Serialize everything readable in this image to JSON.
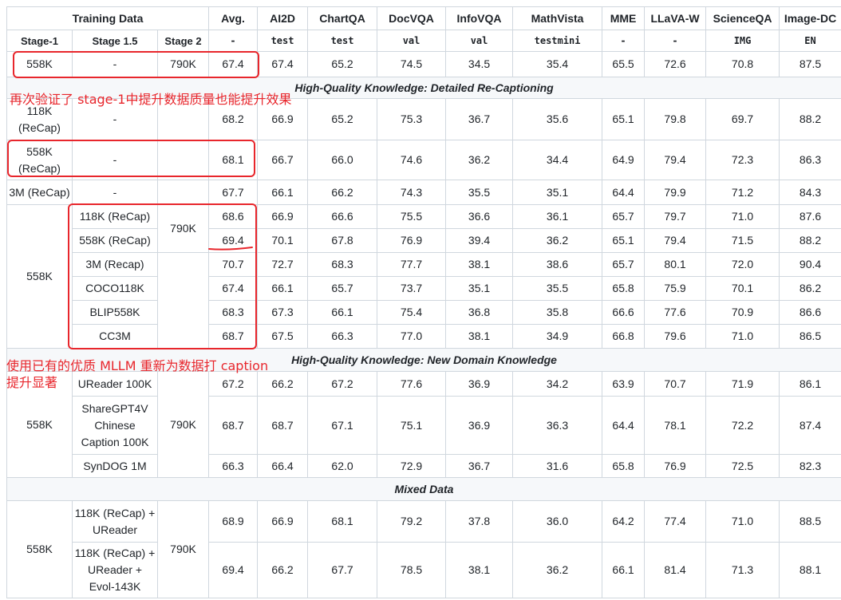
{
  "header": {
    "training_data": "Training Data",
    "metrics": [
      "Avg.",
      "AI2D",
      "ChartQA",
      "DocVQA",
      "InfoVQA",
      "MathVista",
      "MME",
      "LLaVA-W",
      "ScienceQA",
      "Image-DC"
    ],
    "stages": [
      "Stage-1",
      "Stage 1.5",
      "Stage 2"
    ],
    "splits": [
      "-",
      "test",
      "test",
      "val",
      "val",
      "testmini",
      "-",
      "-",
      "IMG",
      "EN"
    ]
  },
  "baseline": {
    "s1": "558K",
    "s15": "-",
    "s2": "790K",
    "values": [
      "67.4",
      "67.4",
      "65.2",
      "74.5",
      "34.5",
      "35.4",
      "65.5",
      "72.6",
      "70.8",
      "87.5"
    ]
  },
  "section1": {
    "title": "High-Quality Knowledge: Detailed Re-Captioning",
    "rows_a": [
      {
        "s1": "118K (ReCap)",
        "s15": "-",
        "values": [
          "68.2",
          "66.9",
          "65.2",
          "75.3",
          "36.7",
          "35.6",
          "65.1",
          "79.8",
          "69.7",
          "88.2"
        ]
      },
      {
        "s1": "558K (ReCap)",
        "s15": "-",
        "values": [
          "68.1",
          "66.7",
          "66.0",
          "74.6",
          "36.2",
          "34.4",
          "64.9",
          "79.4",
          "72.3",
          "86.3"
        ]
      },
      {
        "s1": "3M (ReCap)",
        "s15": "-",
        "values": [
          "67.7",
          "66.1",
          "66.2",
          "74.3",
          "35.5",
          "35.1",
          "64.4",
          "79.9",
          "71.2",
          "84.3"
        ]
      }
    ],
    "group": {
      "s1": "558K",
      "s2": "790K",
      "rows": [
        {
          "s15": "118K (ReCap)",
          "values": [
            "68.6",
            "66.9",
            "66.6",
            "75.5",
            "36.6",
            "36.1",
            "65.7",
            "79.7",
            "71.0",
            "87.6"
          ]
        },
        {
          "s15": "558K (ReCap)",
          "values": [
            "69.4",
            "70.1",
            "67.8",
            "76.9",
            "39.4",
            "36.2",
            "65.1",
            "79.4",
            "71.5",
            "88.2"
          ]
        },
        {
          "s15": "3M (Recap)",
          "values": [
            "70.7",
            "72.7",
            "68.3",
            "77.7",
            "38.1",
            "38.6",
            "65.7",
            "80.1",
            "72.0",
            "90.4"
          ]
        },
        {
          "s15": "COCO118K",
          "values": [
            "67.4",
            "66.1",
            "65.7",
            "73.7",
            "35.1",
            "35.5",
            "65.8",
            "75.9",
            "70.1",
            "86.2"
          ]
        },
        {
          "s15": "BLIP558K",
          "values": [
            "68.3",
            "67.3",
            "66.1",
            "75.4",
            "36.8",
            "35.8",
            "66.6",
            "77.6",
            "70.9",
            "86.6"
          ]
        },
        {
          "s15": "CC3M",
          "values": [
            "68.7",
            "67.5",
            "66.3",
            "77.0",
            "38.1",
            "34.9",
            "66.8",
            "79.6",
            "71.0",
            "86.5"
          ]
        }
      ]
    }
  },
  "section2": {
    "title": "High-Quality Knowledge: New Domain Knowledge",
    "s1": "558K",
    "s2": "790K",
    "rows": [
      {
        "s15": "UReader 100K",
        "values": [
          "67.2",
          "66.2",
          "67.2",
          "77.6",
          "36.9",
          "34.2",
          "63.9",
          "70.7",
          "71.9",
          "86.1"
        ]
      },
      {
        "s15": "ShareGPT4V Chinese Caption 100K",
        "values": [
          "68.7",
          "68.7",
          "67.1",
          "75.1",
          "36.9",
          "36.3",
          "64.4",
          "78.1",
          "72.2",
          "87.4"
        ]
      },
      {
        "s15": "SynDOG 1M",
        "values": [
          "66.3",
          "66.4",
          "62.0",
          "72.9",
          "36.7",
          "31.6",
          "65.8",
          "76.9",
          "72.5",
          "82.3"
        ]
      }
    ]
  },
  "section3": {
    "title": "Mixed Data",
    "s1": "558K",
    "s2": "790K",
    "rows": [
      {
        "s15": "118K (ReCap) + UReader",
        "values": [
          "68.9",
          "66.9",
          "68.1",
          "79.2",
          "37.8",
          "36.0",
          "64.2",
          "77.4",
          "71.0",
          "88.5"
        ]
      },
      {
        "s15": "118K (ReCap) + UReader + Evol-143K",
        "values": [
          "69.4",
          "66.2",
          "67.7",
          "78.5",
          "38.1",
          "36.2",
          "66.1",
          "81.4",
          "71.3",
          "88.1"
        ]
      }
    ]
  },
  "annotations": {
    "note1": "再次验证了 stage-1中提升数据质量也能提升效果",
    "note2_line1": "使用已有的优质 MLLM 重新为数据打 caption",
    "note2_line2": "提升显著",
    "color": "#e8262c"
  }
}
